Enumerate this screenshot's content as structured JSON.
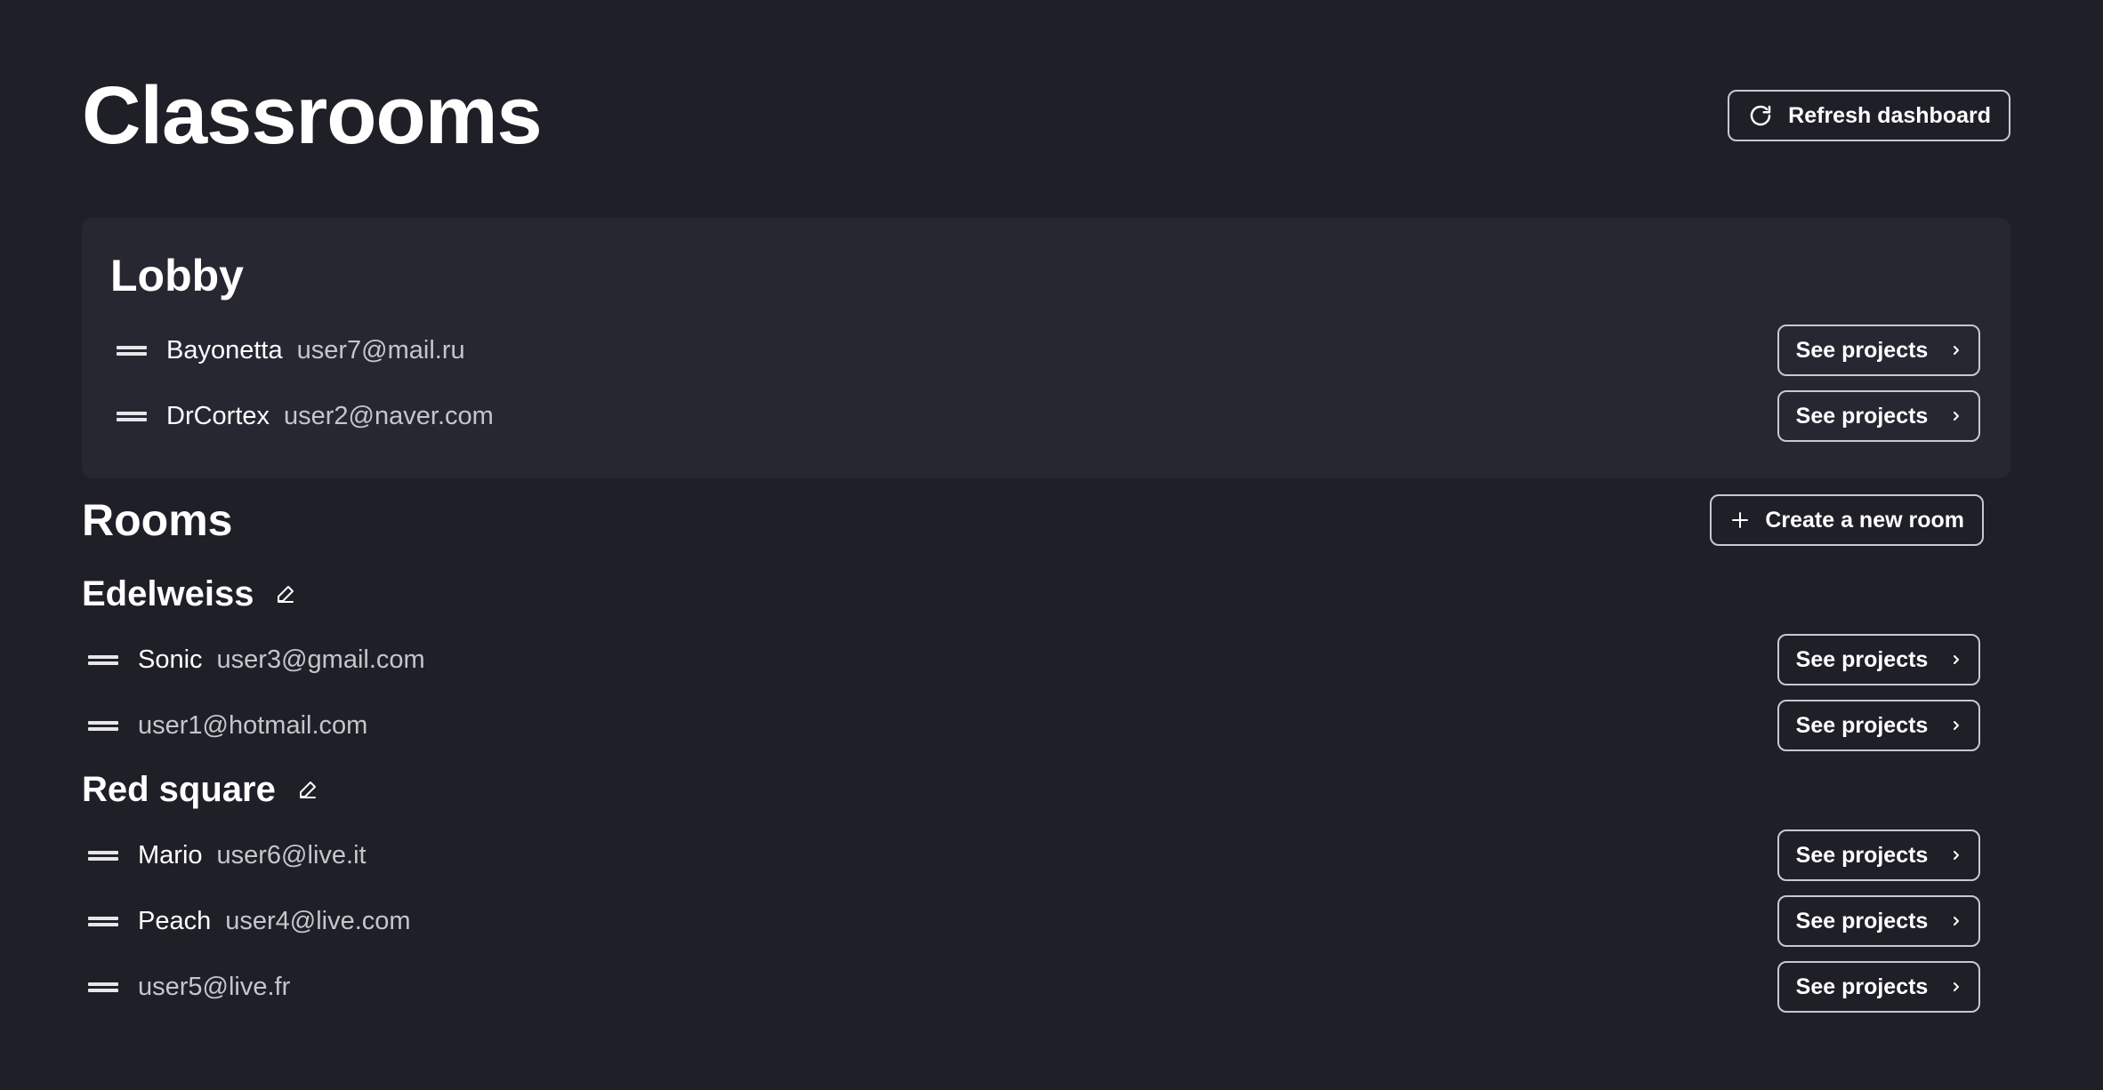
{
  "header": {
    "title": "Classrooms",
    "refresh_label": "Refresh dashboard"
  },
  "lobby": {
    "title": "Lobby",
    "users": [
      {
        "name": "Bayonetta",
        "email": "user7@mail.ru"
      },
      {
        "name": "DrCortex",
        "email": "user2@naver.com"
      }
    ]
  },
  "rooms_section": {
    "title": "Rooms",
    "create_label": "Create a new room"
  },
  "rooms": [
    {
      "name": "Edelweiss",
      "users": [
        {
          "name": "Sonic",
          "email": "user3@gmail.com"
        },
        {
          "name": "",
          "email": "user1@hotmail.com"
        }
      ]
    },
    {
      "name": "Red square",
      "users": [
        {
          "name": "Mario",
          "email": "user6@live.it"
        },
        {
          "name": "Peach",
          "email": "user4@live.com"
        },
        {
          "name": "",
          "email": "user5@live.fr"
        }
      ]
    }
  ],
  "see_projects_label": "See projects",
  "icons": {
    "refresh": "refresh-icon",
    "plus": "plus-icon",
    "edit": "pencil-icon",
    "chevron": "chevron-right-icon",
    "drag": "drag-handle-icon"
  },
  "colors": {
    "background": "#1e1f27",
    "panel": "#262731",
    "text": "#ffffff",
    "muted_text": "#c5c6cc",
    "button_border": "#c8c9d0"
  }
}
